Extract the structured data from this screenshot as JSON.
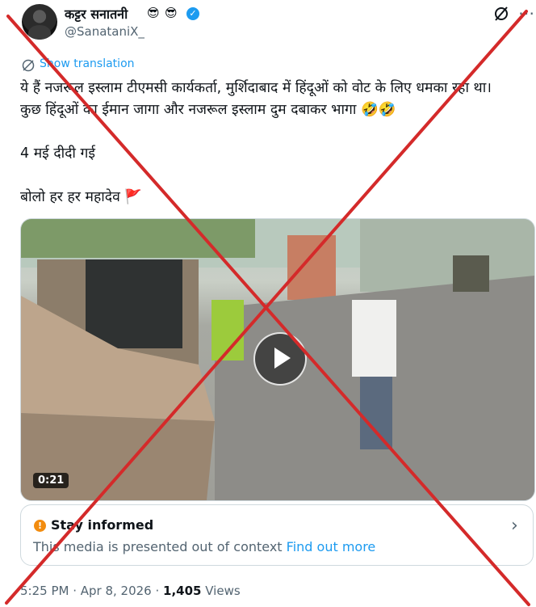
{
  "author": {
    "display_name": "कट्टर सनातनी",
    "emojis": [
      "😎",
      "😎"
    ],
    "handle": "@SanataniX_",
    "verified": true
  },
  "translation_label": "Show translation",
  "tweet": {
    "line1": "ये हैं नजरूल इस्लाम टीएमसी कार्यकर्ता, मुर्शिदाबाद में हिंदूओं को वोट के लिए धमका रहा था। कुछ हिंदूओं का ईमान जागा और नजरूल इस्लाम दुम दबाकर भागा 🤣🤣",
    "line2": "4 मई दीदी गई",
    "line3": "बोलो हर हर महादेव 🚩"
  },
  "media": {
    "duration": "0:21",
    "play_icon": "play-icon"
  },
  "community_note": {
    "title": "Stay informed",
    "body": "This media is presented out of context",
    "link": "Find out more",
    "icon": "alert-icon"
  },
  "meta": {
    "timestamp": "5:25 PM · Apr 8, 2026 · ",
    "views_count": "1,405",
    "views_label": " Views"
  },
  "colors": {
    "accent": "#1d9bf0",
    "cross_red": "#d42a2a",
    "note_orange": "#f28c0f"
  }
}
